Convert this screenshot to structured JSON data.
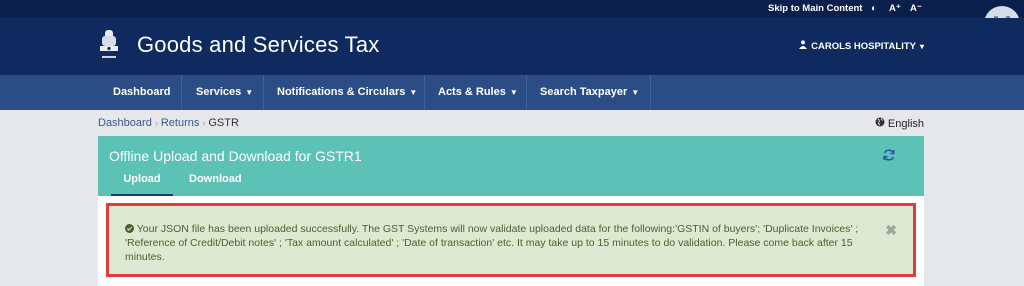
{
  "utility": {
    "skip_link": "Skip to Main Content",
    "contrast": "◐",
    "font_plus": "A⁺",
    "font_minus": "A⁻"
  },
  "header": {
    "title": "Goods and Services Tax",
    "user": "CAROLS HOSPITALITY"
  },
  "nav": {
    "items": [
      {
        "label": "Dashboard"
      },
      {
        "label": "Services"
      },
      {
        "label": "Notifications & Circulars"
      },
      {
        "label": "Acts & Rules"
      },
      {
        "label": "Search Taxpayer"
      }
    ]
  },
  "breadcrumb": {
    "items": [
      "Dashboard",
      "Returns",
      "GSTR"
    ]
  },
  "language": "English",
  "panel": {
    "title": "Offline Upload and Download for GSTR1",
    "tabs": [
      "Upload",
      "Download"
    ],
    "active_tab": "Upload"
  },
  "alert": {
    "message": "Your JSON file has been uploaded successfully. The GST Systems will now validate uploaded data for the following:'GSTIN of buyers'; 'Duplicate Invoices' ; 'Reference of Credit/Debit notes' ; 'Tax amount calculated' ; 'Date of transaction' etc. It may take up to 15 minutes to do validation. Please come back after 15 minutes.",
    "close": "✖"
  },
  "colors": {
    "topbar": "#0b1f4d",
    "header": "#0f2a5f",
    "navbar": "#2c4c86",
    "panel": "#5bc2b5",
    "alert_bg": "#dfe9d1",
    "highlight_border": "#e23b3b"
  }
}
